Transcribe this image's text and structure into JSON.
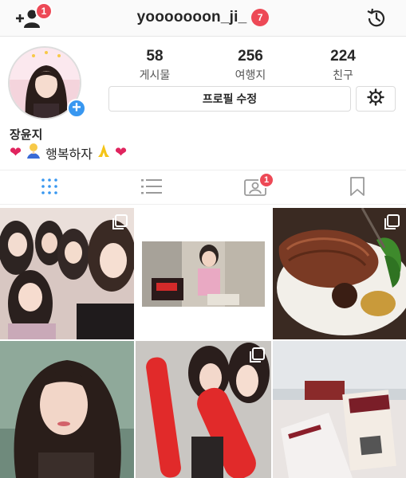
{
  "header": {
    "add_person_badge": "1",
    "username": "yooooooon_ji_",
    "username_badge": "7"
  },
  "profile": {
    "stats": [
      {
        "value": "58",
        "label": "게시물"
      },
      {
        "value": "256",
        "label": "여행지"
      },
      {
        "value": "224",
        "label": "친구"
      }
    ],
    "edit_button": "프로필 수정",
    "display_name": "장윤지",
    "bio_text": "행복하자"
  },
  "tabs": {
    "tagged_badge": "1",
    "items": [
      "grid",
      "list",
      "tagged",
      "saved"
    ]
  },
  "colors": {
    "badge": "#ed4956",
    "accent_blue": "#3897f0",
    "active_tab": "#3897f0",
    "inactive_tab": "#9a9a9a"
  },
  "icons": [
    "add-person-icon",
    "history-icon",
    "settings-icon",
    "grid-icon",
    "list-icon",
    "tagged-icon",
    "bookmark-icon",
    "multi-photo-icon"
  ]
}
